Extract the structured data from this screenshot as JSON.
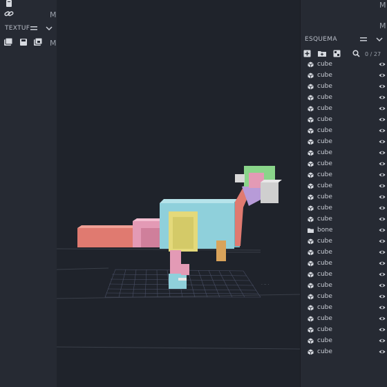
{
  "left_panel": {
    "texture_title": "TEXTUF",
    "top_letter": "M",
    "row_letter": "M"
  },
  "right_panel": {
    "top_letters": [
      "M",
      "M"
    ],
    "outliner_title": "ESQUEMA",
    "count": "0 / 27",
    "items": [
      {
        "label": "cube",
        "type": "cube"
      },
      {
        "label": "cube",
        "type": "cube"
      },
      {
        "label": "cube",
        "type": "cube"
      },
      {
        "label": "cube",
        "type": "cube"
      },
      {
        "label": "cube",
        "type": "cube"
      },
      {
        "label": "cube",
        "type": "cube"
      },
      {
        "label": "cube",
        "type": "cube"
      },
      {
        "label": "cube",
        "type": "cube"
      },
      {
        "label": "cube",
        "type": "cube"
      },
      {
        "label": "cube",
        "type": "cube"
      },
      {
        "label": "cube",
        "type": "cube"
      },
      {
        "label": "cube",
        "type": "cube"
      },
      {
        "label": "cube",
        "type": "cube"
      },
      {
        "label": "cube",
        "type": "cube"
      },
      {
        "label": "cube",
        "type": "cube"
      },
      {
        "label": "bone",
        "type": "folder"
      },
      {
        "label": "cube",
        "type": "cube"
      },
      {
        "label": "cube",
        "type": "cube"
      },
      {
        "label": "cube",
        "type": "cube"
      },
      {
        "label": "cube",
        "type": "cube"
      },
      {
        "label": "cube",
        "type": "cube"
      },
      {
        "label": "cube",
        "type": "cube"
      },
      {
        "label": "cube",
        "type": "cube"
      },
      {
        "label": "cube",
        "type": "cube"
      },
      {
        "label": "cube",
        "type": "cube"
      },
      {
        "label": "cube",
        "type": "cube"
      },
      {
        "label": "cube",
        "type": "cube"
      }
    ]
  },
  "icons": {
    "file": "file-icon",
    "link": "link-icon",
    "menu": "menu-icon",
    "chevron": "chevron-down-icon",
    "add_cube": "add-cube-icon",
    "add_folder": "add-folder-icon",
    "search": "search-icon",
    "visibility": "eye-icon"
  },
  "colors": {
    "panel": "#262a33",
    "viewport": "#1f232b",
    "text": "#c9cdd5",
    "salmon": "#e07a70",
    "pink": "#e39ab5",
    "cyan": "#8fd0db",
    "yellow": "#e4d97a",
    "green": "#8ad58a",
    "purple": "#b79bd8",
    "orange": "#d9a35a",
    "light": "#d8d8d8"
  }
}
